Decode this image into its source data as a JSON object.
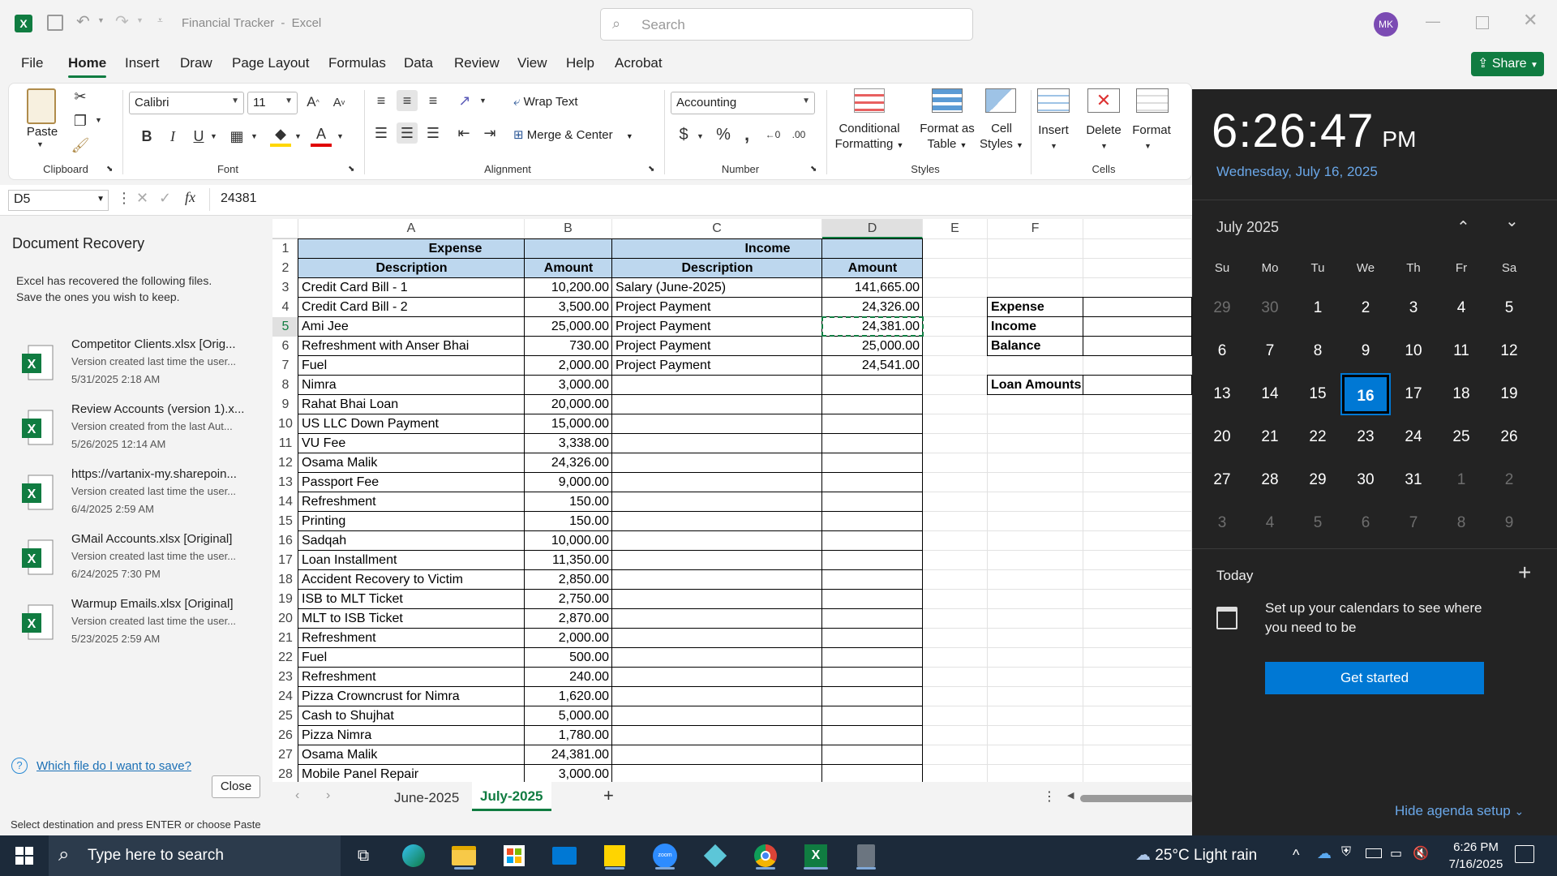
{
  "titlebar": {
    "doc_title": "Financial Tracker",
    "app_name": "Excel",
    "title_sep": "-",
    "search_placeholder": "Search",
    "avatar_initials": "MK"
  },
  "ribbon_tabs": [
    "File",
    "Home",
    "Insert",
    "Draw",
    "Page Layout",
    "Formulas",
    "Data",
    "Review",
    "View",
    "Help",
    "Acrobat"
  ],
  "share_label": "Share",
  "ribbon": {
    "paste": "Paste",
    "font_name": "Calibri",
    "font_size": "11",
    "wrap_text": "Wrap Text",
    "merge_center": "Merge & Center",
    "number_format": "Accounting",
    "conditional_formatting": [
      "Conditional",
      "Formatting"
    ],
    "format_as_table": [
      "Format as",
      "Table"
    ],
    "cell_styles": [
      "Cell",
      "Styles"
    ],
    "insert": "Insert",
    "delete": "Delete",
    "format": "Format",
    "groups": {
      "clipboard": "Clipboard",
      "font": "Font",
      "alignment": "Alignment",
      "number": "Number",
      "styles": "Styles",
      "cells": "Cells"
    }
  },
  "formula_bar": {
    "name_box": "D5",
    "formula": "24381",
    "fx": "fx"
  },
  "recovery": {
    "title": "Document Recovery",
    "desc_line1": "Excel has recovered the following files.",
    "desc_line2": "Save the ones you wish to keep.",
    "files": [
      {
        "name": "Competitor Clients.xlsx  [Orig...",
        "desc": "Version created last time the user...",
        "date": "5/31/2025 2:18 AM"
      },
      {
        "name": "Review Accounts (version 1).x...",
        "desc": "Version created from the last Aut...",
        "date": "5/26/2025 12:14 AM"
      },
      {
        "name": "https://vartanix-my.sharepoin...",
        "desc": "Version created last time the user...",
        "date": "6/4/2025 2:59 AM"
      },
      {
        "name": "GMail Accounts.xlsx  [Original]",
        "desc": "Version created last time the user...",
        "date": "6/24/2025 7:30 PM"
      },
      {
        "name": "Warmup Emails.xlsx  [Original]",
        "desc": "Version created last time the user...",
        "date": "5/23/2025 2:59 AM"
      }
    ],
    "help_link": "Which file do I want to save?",
    "close_label": "Close"
  },
  "sheet": {
    "columns": [
      "A",
      "B",
      "C",
      "D",
      "E",
      "F"
    ],
    "header1_expense": "Expense",
    "header1_income": "Income",
    "header2": [
      "Description",
      "Amount",
      "Description",
      "Amount"
    ],
    "expense_rows": [
      [
        "Credit Card Bill - 1",
        "10,200.00"
      ],
      [
        "Credit Card Bill - 2",
        "3,500.00"
      ],
      [
        "Ami Jee",
        "25,000.00"
      ],
      [
        "Refreshment with Anser Bhai",
        "730.00"
      ],
      [
        "Fuel",
        "2,000.00"
      ],
      [
        "Nimra",
        "3,000.00"
      ],
      [
        "Rahat Bhai Loan",
        "20,000.00"
      ],
      [
        "US LLC Down Payment",
        "15,000.00"
      ],
      [
        "VU Fee",
        "3,338.00"
      ],
      [
        "Osama Malik",
        "24,326.00"
      ],
      [
        "Passport Fee",
        "9,000.00"
      ],
      [
        "Refreshment",
        "150.00"
      ],
      [
        "Printing",
        "150.00"
      ],
      [
        "Sadqah",
        "10,000.00"
      ],
      [
        "Loan Installment",
        "11,350.00"
      ],
      [
        "Accident Recovery to Victim",
        "2,850.00"
      ],
      [
        "ISB to MLT Ticket",
        "2,750.00"
      ],
      [
        "MLT to ISB Ticket",
        "2,870.00"
      ],
      [
        "Refreshment",
        "2,000.00"
      ],
      [
        "Fuel",
        "500.00"
      ],
      [
        "Refreshment",
        "240.00"
      ],
      [
        "Pizza Crowncrust for Nimra",
        "1,620.00"
      ],
      [
        "Cash to Shujhat",
        "5,000.00"
      ],
      [
        "Pizza Nimra",
        "1,780.00"
      ],
      [
        "Osama Malik",
        "24,381.00"
      ],
      [
        "Mobile Panel Repair",
        "3,000.00"
      ]
    ],
    "income_rows": [
      [
        "Salary (June-2025)",
        "141,665.00"
      ],
      [
        "Project Payment",
        "24,326.00"
      ],
      [
        "Project Payment",
        "24,381.00"
      ],
      [
        "Project Payment",
        "25,000.00"
      ],
      [
        "Project Payment",
        "24,541.00"
      ]
    ],
    "summary_labels": [
      "Expense",
      "Income",
      "Balance"
    ],
    "loan_label": "Loan Amounts",
    "sheet_tabs": [
      "June-2025",
      "July-2025"
    ],
    "active_tab": "July-2025"
  },
  "status_text": "Select destination and press ENTER or choose Paste",
  "clock": {
    "time": "6:26:47",
    "ampm": "PM",
    "date": "Wednesday, July 16, 2025",
    "month": "July 2025",
    "weekdays": [
      "Su",
      "Mo",
      "Tu",
      "We",
      "Th",
      "Fr",
      "Sa"
    ],
    "weeks": [
      [
        "29",
        "30",
        "1",
        "2",
        "3",
        "4",
        "5"
      ],
      [
        "6",
        "7",
        "8",
        "9",
        "10",
        "11",
        "12"
      ],
      [
        "13",
        "14",
        "15",
        "16",
        "17",
        "18",
        "19"
      ],
      [
        "20",
        "21",
        "22",
        "23",
        "24",
        "25",
        "26"
      ],
      [
        "27",
        "28",
        "29",
        "30",
        "31",
        "1",
        "2"
      ],
      [
        "3",
        "4",
        "5",
        "6",
        "7",
        "8",
        "9"
      ]
    ],
    "today": "16",
    "agenda_title": "Today",
    "agenda_text_1": "Set up your calendars to see where",
    "agenda_text_2": "you need to be",
    "get_started": "Get started",
    "hide_agenda": "Hide agenda setup"
  },
  "taskbar": {
    "search_placeholder": "Type here to search",
    "weather": "25°C  Light rain",
    "time": "6:26 PM",
    "date": "7/16/2025"
  },
  "colors": {
    "excel_green": "#107c41",
    "header_blue": "#bdd7ee",
    "accent_blue": "#0078d4",
    "flyout_bg": "#232323",
    "taskbar_bg": "#1c2a3a"
  }
}
